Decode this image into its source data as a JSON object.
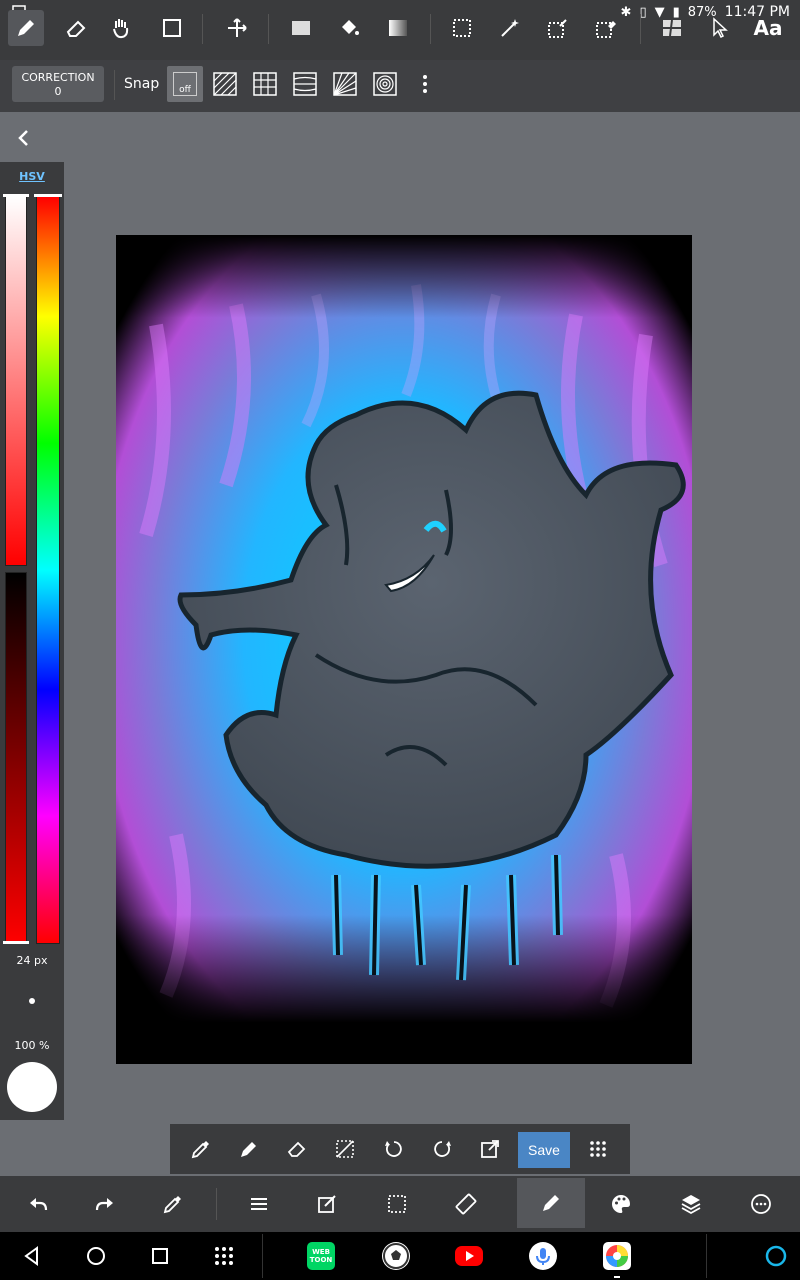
{
  "status": {
    "battery": "87%",
    "time": "11:47 PM"
  },
  "toolbar": {
    "text_tool_label": "Aa"
  },
  "subbar": {
    "correction_label": "CORRECTION",
    "correction_value": "0",
    "snap_label": "Snap",
    "snap_off_label": "off"
  },
  "colorpanel": {
    "mode_label": "HSV",
    "brush_size": "24 px",
    "opacity": "100 %"
  },
  "quickbar": {
    "save_label": "Save"
  },
  "apps": {
    "webtoon_label": "WEB TOON"
  },
  "colors": {
    "accent": "#4a86c5",
    "toolbar_bg": "#3a3b3d",
    "workspace_bg": "#6b6e73",
    "selected_color": "#ffffff"
  }
}
